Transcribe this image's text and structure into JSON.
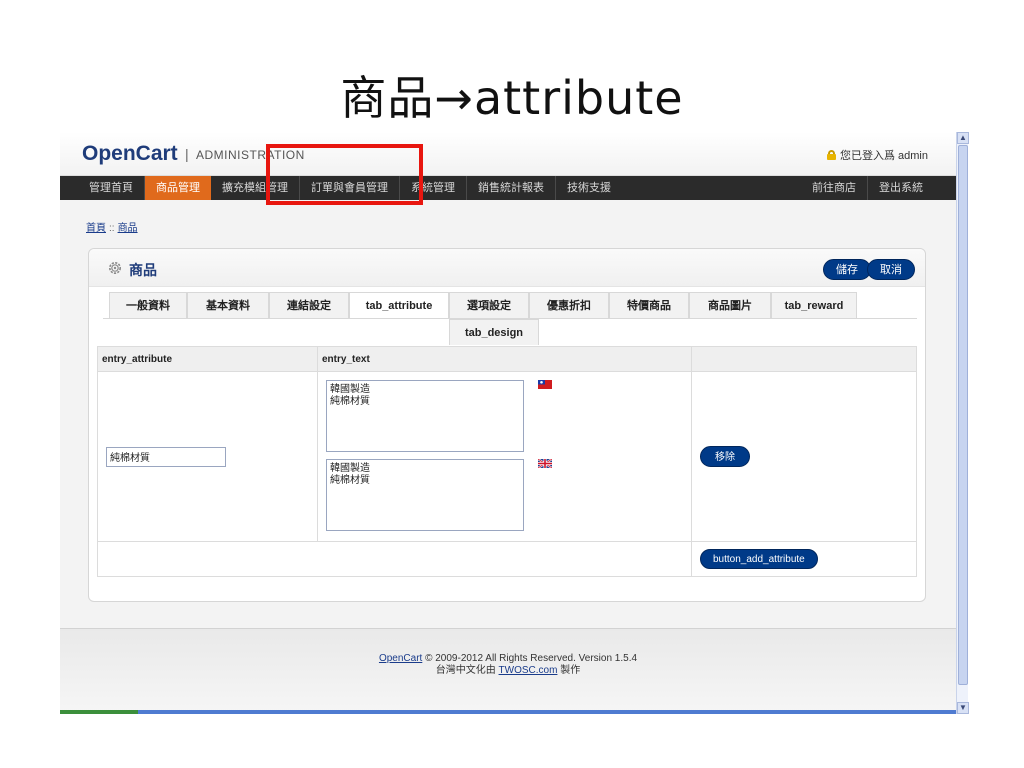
{
  "slide": {
    "title": "商品→attribute"
  },
  "header": {
    "logo": "OpenCart",
    "logo_sep": "|",
    "logo_sub": "ADMINISTRATION",
    "login_text": "您已登入爲 admin"
  },
  "nav": {
    "items": [
      "管理首頁",
      "商品管理",
      "擴充模組管理",
      "訂單與會員管理",
      "系統管理",
      "銷售統計報表",
      "技術支援"
    ],
    "right_items": [
      "前往商店",
      "登出系統"
    ]
  },
  "breadcrumb": [
    "首頁",
    "::",
    "商品"
  ],
  "box": {
    "title": "商品",
    "save_label": "儲存",
    "cancel_label": "取消"
  },
  "tabs": {
    "row1": [
      "一般資料",
      "基本資料",
      "連結設定",
      "tab_attribute",
      "選項設定",
      "優惠折扣",
      "特價商品",
      "商品圖片",
      "tab_reward"
    ],
    "row2": [
      "tab_design"
    ]
  },
  "table": {
    "headers": [
      "entry_attribute",
      "entry_text",
      ""
    ],
    "attribute_value": "純棉材質",
    "text_1": "韓國製造\n純棉材質",
    "text_2": "韓國製造\n純棉材質",
    "remove_label": "移除",
    "add_label": "button_add_attribute"
  },
  "footer": {
    "line1_link": "OpenCart",
    "line1_text": " © 2009-2012 All Rights Reserved. Version 1.5.4",
    "line2_pre": "台灣中文化由 ",
    "line2_link": "TWOSC.com",
    "line2_post": " 製作"
  },
  "colors": {
    "nav_active": "#e06a1c",
    "button": "#003a88",
    "highlight": "#e8160f"
  }
}
